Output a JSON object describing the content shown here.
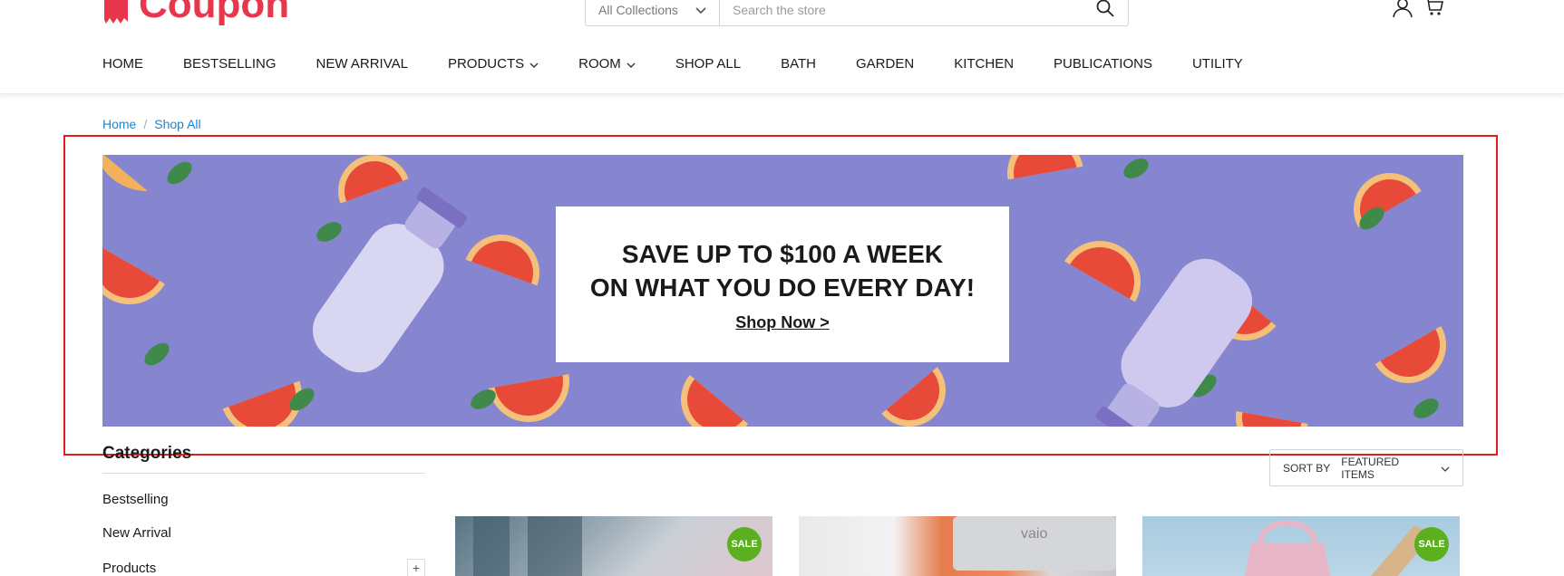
{
  "brand": {
    "name": "Coupon",
    "color": "#e8374c"
  },
  "search": {
    "collection_label": "All Collections",
    "placeholder": "Search the store"
  },
  "header_icons": [
    "user-icon",
    "cart-icon"
  ],
  "nav": {
    "items": [
      {
        "label": "HOME",
        "dropdown": false
      },
      {
        "label": "BESTSELLING",
        "dropdown": false
      },
      {
        "label": "NEW ARRIVAL",
        "dropdown": false
      },
      {
        "label": "PRODUCTS",
        "dropdown": true
      },
      {
        "label": "ROOM",
        "dropdown": true
      },
      {
        "label": "SHOP ALL",
        "dropdown": false
      },
      {
        "label": "BATH",
        "dropdown": false
      },
      {
        "label": "GARDEN",
        "dropdown": false
      },
      {
        "label": "KITCHEN",
        "dropdown": false
      },
      {
        "label": "PUBLICATIONS",
        "dropdown": false
      },
      {
        "label": "UTILITY",
        "dropdown": false
      }
    ]
  },
  "breadcrumb": {
    "items": [
      "Home",
      "Shop All"
    ],
    "separator": "/"
  },
  "banner": {
    "line1": "SAVE UP TO $100 A WEEK",
    "line2": "ON WHAT YOU DO EVERY DAY!",
    "cta": "Shop Now >",
    "background_color": "#8585d0"
  },
  "sidebar": {
    "title": "Categories",
    "items": [
      {
        "label": "Bestselling",
        "expandable": false
      },
      {
        "label": "New Arrival",
        "expandable": false
      },
      {
        "label": "Products",
        "expandable": true
      }
    ]
  },
  "sort": {
    "label": "SORT BY",
    "value": "FEATURED ITEMS"
  },
  "products": [
    {
      "badge": "SALE"
    },
    {
      "badge": ""
    },
    {
      "badge": "SALE"
    }
  ],
  "colors": {
    "accent": "#e8374c",
    "link": "#1a86d0",
    "sale_badge": "#5cb01f",
    "highlight": "#e31b1b"
  }
}
